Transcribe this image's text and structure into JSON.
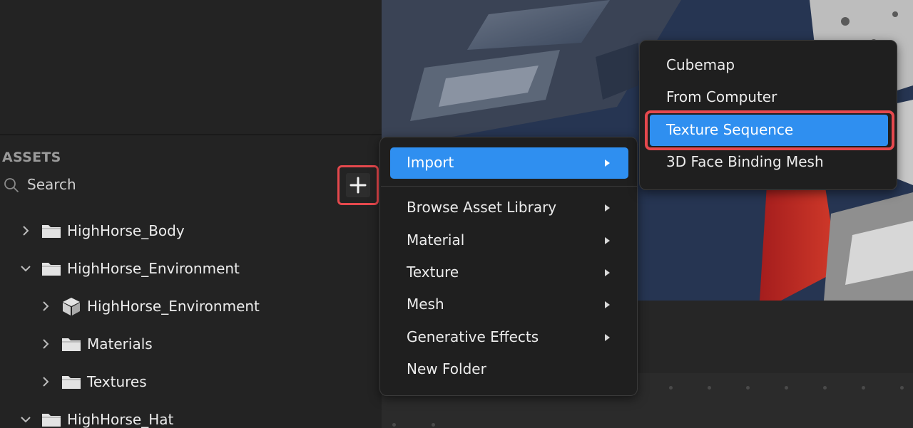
{
  "assets_panel": {
    "title": "ASSETS",
    "search_placeholder": "Search",
    "add_button_icon": "plus-icon"
  },
  "tree": [
    {
      "label": "HighHorse_Body",
      "expanded": false,
      "icon": "folder-icon",
      "depth": 0
    },
    {
      "label": "HighHorse_Environment",
      "expanded": true,
      "icon": "folder-icon",
      "depth": 0
    },
    {
      "label": "HighHorse_Environment",
      "expanded": false,
      "icon": "cube-icon",
      "depth": 1
    },
    {
      "label": "Materials",
      "expanded": false,
      "icon": "folder-icon",
      "depth": 1
    },
    {
      "label": "Textures",
      "expanded": false,
      "icon": "folder-icon",
      "depth": 1
    },
    {
      "label": "HighHorse_Hat",
      "expanded": true,
      "icon": "folder-icon",
      "depth": 0
    }
  ],
  "context_menu": {
    "items": [
      {
        "label": "Import",
        "has_submenu": true,
        "active": true
      },
      {
        "label": "Browse Asset Library",
        "has_submenu": true
      },
      {
        "label": "Material",
        "has_submenu": true
      },
      {
        "label": "Texture",
        "has_submenu": true
      },
      {
        "label": "Mesh",
        "has_submenu": true
      },
      {
        "label": "Generative Effects",
        "has_submenu": true
      },
      {
        "label": "New Folder",
        "has_submenu": false
      }
    ]
  },
  "import_submenu": {
    "items": [
      {
        "label": "Cubemap"
      },
      {
        "label": "From Computer"
      },
      {
        "label": "Texture Sequence",
        "active": true
      },
      {
        "label": "3D Face Binding Mesh"
      }
    ]
  },
  "colors": {
    "accent": "#2f8ff0",
    "highlight": "#e5484d",
    "panel_bg": "#232323"
  }
}
